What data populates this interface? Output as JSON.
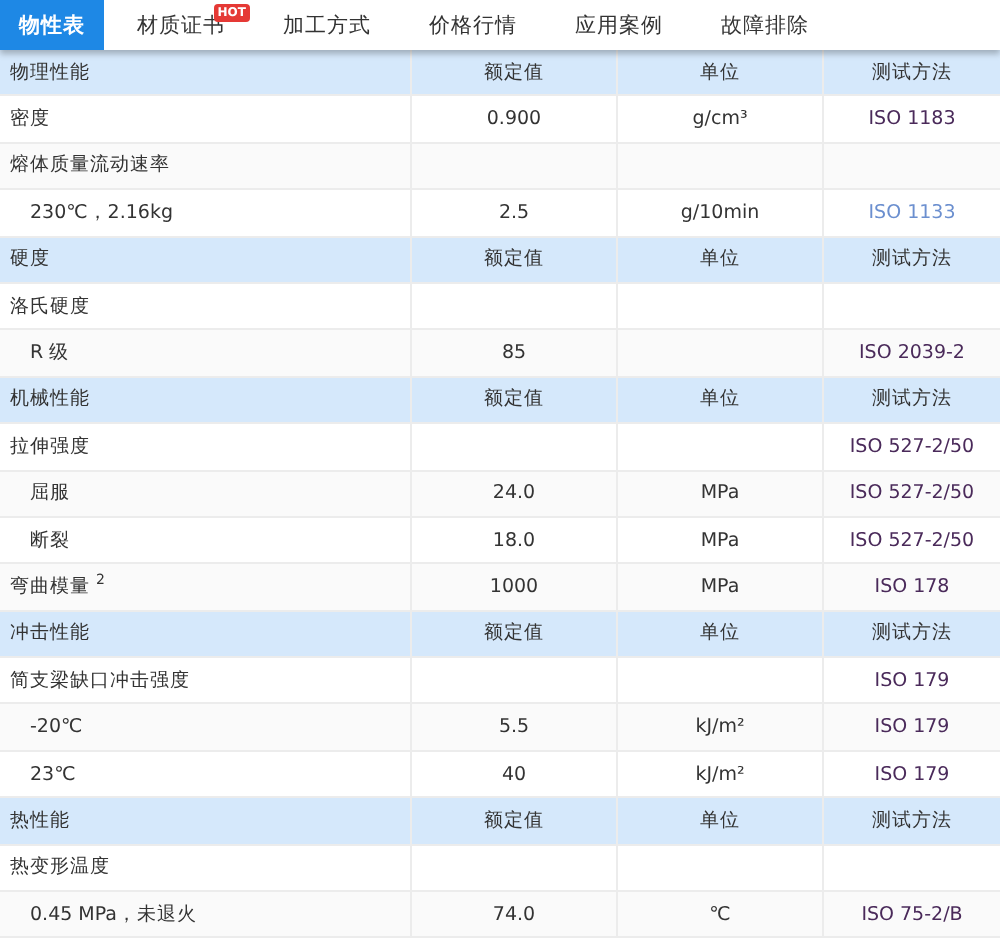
{
  "tabs": [
    {
      "label": "物性表",
      "selected": true
    },
    {
      "label": "材质证书",
      "selected": false,
      "badge": "HOT"
    },
    {
      "label": "加工方式",
      "selected": false
    },
    {
      "label": "价格行情",
      "selected": false
    },
    {
      "label": "应用案例",
      "selected": false
    },
    {
      "label": "故障排除",
      "selected": false
    }
  ],
  "rows": [
    {
      "kind": "header",
      "cells": [
        "物理性能",
        "额定值",
        "单位",
        "测试方法"
      ]
    },
    {
      "kind": "item",
      "cells": [
        "密度",
        "0.900",
        "g/cm³",
        "ISO 1183"
      ],
      "visited": true
    },
    {
      "kind": "item",
      "cells": [
        "熔体质量流动速率"
      ]
    },
    {
      "kind": "sub",
      "cells": [
        "230℃，2.16kg",
        "2.5",
        "g/10min",
        "ISO 1133"
      ],
      "visited": false
    },
    {
      "kind": "header",
      "cells": [
        "硬度",
        "额定值",
        "单位",
        "测试方法"
      ]
    },
    {
      "kind": "item",
      "cells": [
        "洛氏硬度"
      ]
    },
    {
      "kind": "sub",
      "cells": [
        "R 级",
        "85",
        "",
        "ISO 2039-2"
      ],
      "visited": true
    },
    {
      "kind": "header",
      "cells": [
        "机械性能",
        "额定值",
        "单位",
        "测试方法"
      ]
    },
    {
      "kind": "item",
      "cells": [
        "拉伸强度",
        "",
        "",
        "ISO 527-2/50"
      ],
      "visited": true
    },
    {
      "kind": "sub",
      "cells": [
        "屈服",
        "24.0",
        "MPa",
        "ISO 527-2/50"
      ],
      "visited": true
    },
    {
      "kind": "sub",
      "cells": [
        "断裂",
        "18.0",
        "MPa",
        "ISO 527-2/50"
      ],
      "visited": true
    },
    {
      "kind": "item",
      "cells": [
        "弯曲模量 $^{2}$",
        "1000",
        "MPa",
        "ISO 178"
      ],
      "visited": true
    },
    {
      "kind": "header",
      "cells": [
        "冲击性能",
        "额定值",
        "单位",
        "测试方法"
      ]
    },
    {
      "kind": "item",
      "cells": [
        "简支梁缺口冲击强度",
        "",
        "",
        "ISO 179"
      ],
      "visited": true
    },
    {
      "kind": "sub",
      "cells": [
        "-20℃",
        "5.5",
        "kJ/m²",
        "ISO 179"
      ],
      "visited": true
    },
    {
      "kind": "sub",
      "cells": [
        "23℃",
        "40",
        "kJ/m²",
        "ISO 179"
      ],
      "visited": true
    },
    {
      "kind": "header",
      "cells": [
        "热性能",
        "额定值",
        "单位",
        "测试方法"
      ]
    },
    {
      "kind": "item",
      "cells": [
        "热变形温度"
      ]
    },
    {
      "kind": "sub",
      "cells": [
        "0.45 MPa，未退火",
        "74.0",
        "℃",
        "ISO 75-2/B"
      ],
      "visited": true
    }
  ]
}
